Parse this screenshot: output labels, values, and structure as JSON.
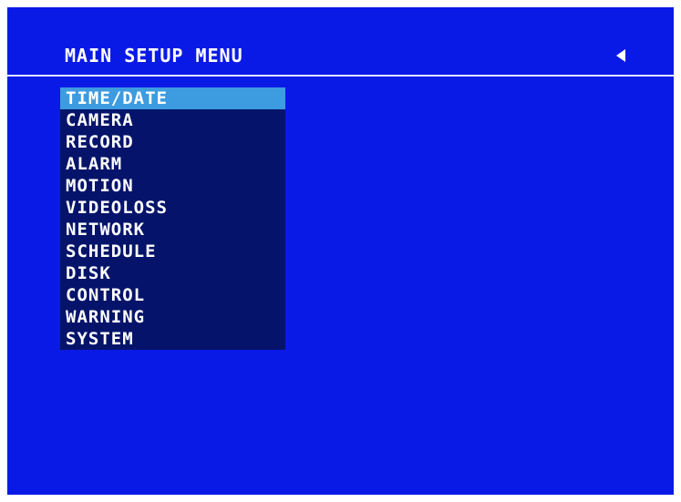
{
  "header": {
    "title": "MAIN SETUP MENU",
    "back_icon": "left-triangle-icon"
  },
  "menu": {
    "selected_index": 0,
    "items": [
      {
        "label": "TIME/DATE"
      },
      {
        "label": "CAMERA"
      },
      {
        "label": "RECORD"
      },
      {
        "label": "ALARM"
      },
      {
        "label": "MOTION"
      },
      {
        "label": "VIDEOLOSS"
      },
      {
        "label": "NETWORK"
      },
      {
        "label": "SCHEDULE"
      },
      {
        "label": "DISK"
      },
      {
        "label": "CONTROL"
      },
      {
        "label": "WARNING"
      },
      {
        "label": "SYSTEM"
      }
    ]
  },
  "colors": {
    "screen_background": "#0a1ae6",
    "menu_background": "#05146a",
    "selected_highlight": "#3d9be0",
    "text": "#ffffff"
  }
}
